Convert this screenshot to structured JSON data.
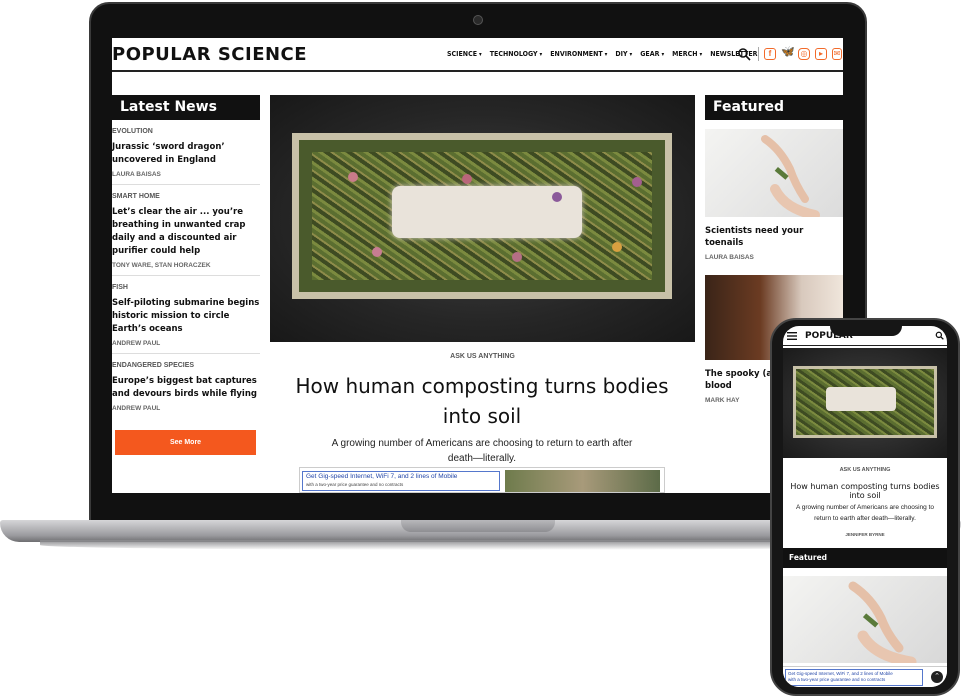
{
  "site": {
    "logo": "POPULAR SCIENCE",
    "nav": [
      {
        "label": "SCIENCE",
        "has_caret": true
      },
      {
        "label": "TECHNOLOGY",
        "has_caret": true
      },
      {
        "label": "ENVIRONMENT",
        "has_caret": true
      },
      {
        "label": "DIY",
        "has_caret": true
      },
      {
        "label": "GEAR",
        "has_caret": true
      },
      {
        "label": "MERCH",
        "has_caret": true
      },
      {
        "label": "NEWSLETTER",
        "has_caret": false
      }
    ],
    "social_icons": [
      "facebook-icon",
      "bluesky-icon",
      "instagram-icon",
      "youtube-icon",
      "email-icon"
    ],
    "accent_color": "#f4581e"
  },
  "latest_news": {
    "title": "Latest News",
    "items": [
      {
        "category": "EVOLUTION",
        "headline": "Jurassic ‘sword dragon’ uncovered in England",
        "byline": "LAURA BAISAS"
      },
      {
        "category": "SMART HOME",
        "headline": "Let’s clear the air ... you’re breathing in unwanted crap daily and a discounted air purifier could help",
        "byline": "TONY WARE, STAN HORACZEK"
      },
      {
        "category": "FISH",
        "headline": "Self-piloting submarine begins historic mission to circle Earth’s oceans",
        "byline": "ANDREW PAUL"
      },
      {
        "category": "ENDANGERED SPECIES",
        "headline": "Europe’s biggest bat captures and devours birds while flying",
        "byline": "ANDREW PAUL"
      }
    ],
    "see_more": "See More"
  },
  "main_story": {
    "kicker": "ASK US ANYTHING",
    "headline": "How human composting turns bodies into soil",
    "dek": "A growing number of Americans are choosing to return to earth after death—literally."
  },
  "ad": {
    "line1": "Get Gig-speed Internet, WiFi 7, and 2 lines of Mobile",
    "line2": "with a two-year price guarantee and no contracts"
  },
  "featured": {
    "title": "Featured",
    "items": [
      {
        "headline": "Scientists need your toenails",
        "byline": "LAURA BAISAS"
      },
      {
        "headline": "The spooky (and s",
        "headline_2": "blood",
        "byline": "MARK HAY"
      }
    ]
  },
  "phone": {
    "logo": "POPULAR",
    "kicker": "ASK US ANYTHING",
    "headline": "How human composting turns bodies into soil",
    "dek": "A growing number of Americans are choosing to return to earth after death—literally.",
    "byline": "JENNIFER BYRNE",
    "featured_title": "Featured",
    "ad_line1": "Get Gig-speed Internet, WiFi 7, and 2 lines of Mobile",
    "ad_line2": "with a two-year price guarantee and no contracts"
  }
}
